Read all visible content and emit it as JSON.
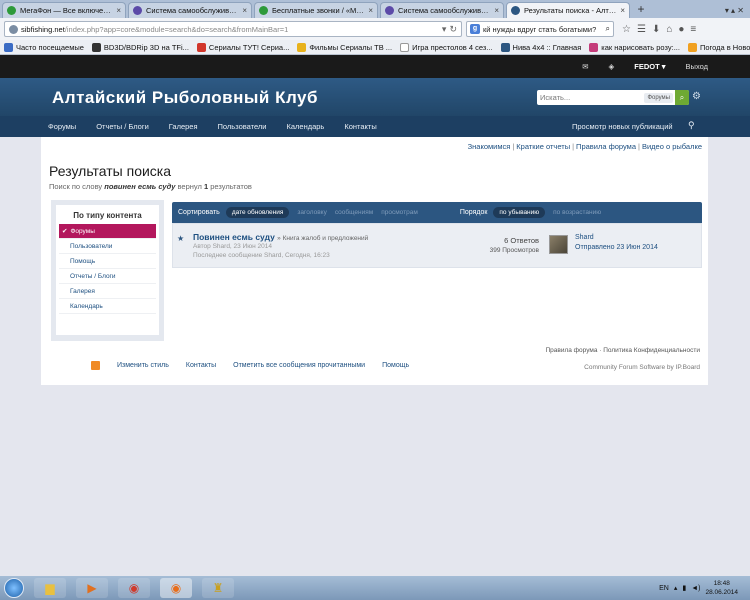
{
  "browser": {
    "tabs": [
      {
        "label": "МегаФон — Все включено...",
        "color": "#2e9a3a",
        "active": false
      },
      {
        "label": "Система самообслужива...",
        "color": "#5c4aa8",
        "active": false
      },
      {
        "label": "Бесплатные звонки / «Ме...",
        "color": "#2e9a3a",
        "active": false
      },
      {
        "label": "Система самообслужива...",
        "color": "#5c4aa8",
        "active": false
      },
      {
        "label": "Результаты поиска - Алта...",
        "color": "#2c5681",
        "active": true
      }
    ],
    "new_tab": "+",
    "url_host": "sibfishing.net",
    "url_rest": "/index.php?app=core&module=search&do=search&fromMainBar=1",
    "search_value": "кй нужды вдруг стать богатыми?",
    "bookmarks": [
      {
        "label": "Часто посещаемые",
        "color": "#3a6bc4"
      },
      {
        "label": "BD3D/BDRip 3D на TFi...",
        "color": "#333333"
      },
      {
        "label": "Сериалы ТУТ! Сериа...",
        "color": "#d1362b"
      },
      {
        "label": "Фильмы Сериалы ТВ ...",
        "color": "#e8b21c"
      },
      {
        "label": "Игра престолов 4 сез...",
        "color": "#ffffff"
      },
      {
        "label": "Нива 4х4 :: Главная",
        "color": "#2c5681"
      },
      {
        "label": "как нарисовать розу:...",
        "color": "#c43b7a"
      },
      {
        "label": "Погода в Новоалтай...",
        "color": "#f0a020"
      }
    ]
  },
  "site": {
    "top_user": "FEDOT ▾",
    "top_logout": "Выход",
    "logo": "Алтайский Рыболовный Клуб",
    "search_placeholder": "Искать...",
    "search_scope": "Форумы",
    "nav": [
      "Форумы",
      "Отчеты / Блоги",
      "Галерея",
      "Пользователи",
      "Календарь",
      "Контакты"
    ],
    "nav_right": "Просмотр новых публикаций",
    "quick_links": [
      "Знакомимся",
      "Краткие отчеты",
      "Правила форума",
      "Видео о рыбалке"
    ],
    "page_title": "Результаты поиска",
    "sub_prefix": "Поиск по слову",
    "sub_query": "повинен есмь суду",
    "sub_mid": "вернул",
    "sub_count": "1",
    "sub_suffix": "результатов",
    "sidebar": {
      "heading": "По типу контента",
      "items": [
        "Форумы",
        "Пользователи",
        "Помощь",
        "Отчеты / Блоги",
        "Галерея",
        "Календарь"
      ]
    },
    "sortbar": {
      "sort_label": "Сортировать",
      "sort_active": "дате обновления",
      "sort_opts": [
        "заголовку",
        "сообщениям",
        "просмотрам"
      ],
      "order_label": "Порядок",
      "order_active": "по убыванию",
      "order_opt": "по возрастанию"
    },
    "result": {
      "title": "Повинен есмь суду",
      "category": "» Книга жалоб и предложений",
      "author": "Автор Shard, 23 Июн 2014",
      "last": "Последнее сообщение Shard, Сегодня, 16:23",
      "answers": "6 Ответов",
      "views": "399 Просмотров",
      "user": "Shard",
      "date": "Отправлено 23 Июн 2014"
    },
    "footer": {
      "right": "Правила форума · Политика Конфиденциальности",
      "links": [
        "Изменить стиль",
        "Контакты",
        "Отметить все сообщения прочитанными",
        "Помощь"
      ],
      "credit": "Community Forum Software by IP.Board"
    }
  },
  "taskbar": {
    "time": "18:48",
    "date": "28.06.2014"
  }
}
